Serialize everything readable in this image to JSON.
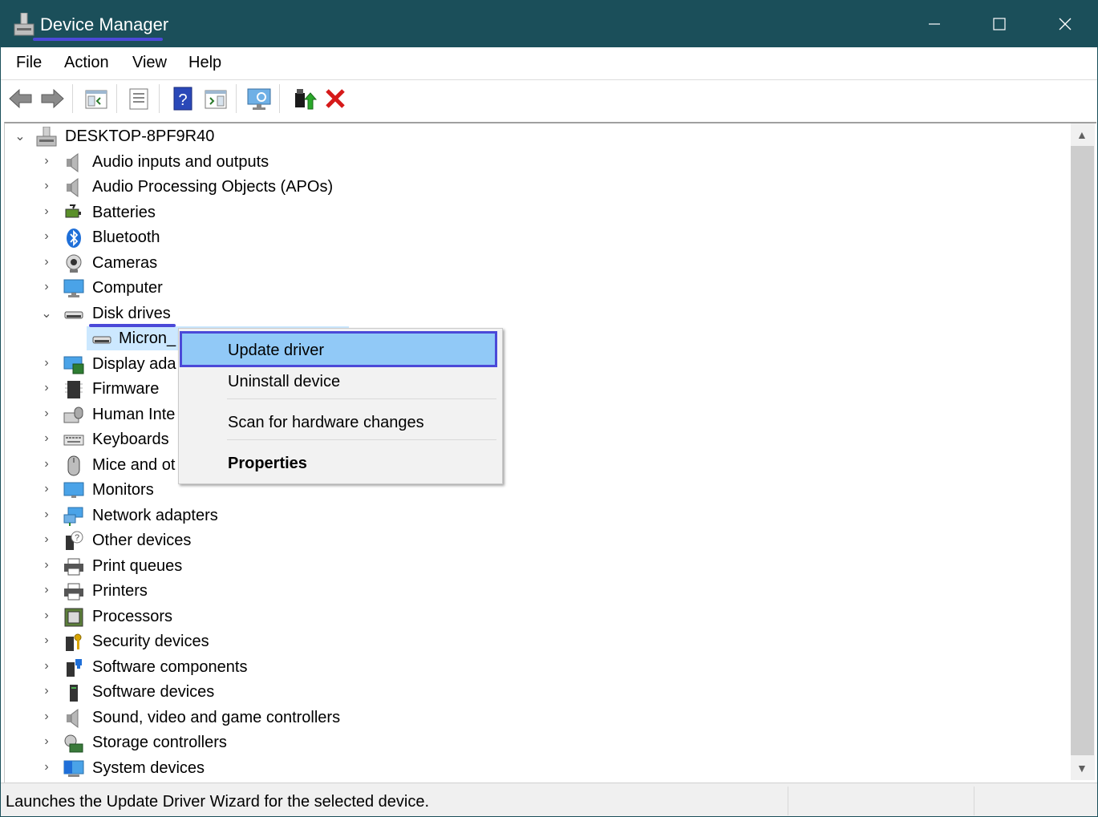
{
  "window": {
    "title": "Device Manager",
    "colors": {
      "titlebar": "#1b4f5a",
      "highlight": "#4b49d8",
      "selection": "#91c9f7"
    }
  },
  "menubar": {
    "items": [
      "File",
      "Action",
      "View",
      "Help"
    ]
  },
  "toolbar": {
    "icons": [
      "back-arrow-icon",
      "forward-arrow-icon",
      "show-hide-console-tree-icon",
      "properties-icon",
      "help-icon",
      "action-pane-icon",
      "monitor-scan-icon",
      "update-driver-icon",
      "uninstall-icon"
    ]
  },
  "tree": {
    "root": "DESKTOP-8PF9R40",
    "categories": [
      {
        "label": "Audio inputs and outputs",
        "icon": "speaker-icon"
      },
      {
        "label": "Audio Processing Objects (APOs)",
        "icon": "speaker-icon"
      },
      {
        "label": "Batteries",
        "icon": "battery-icon"
      },
      {
        "label": "Bluetooth",
        "icon": "bluetooth-icon"
      },
      {
        "label": "Cameras",
        "icon": "camera-icon"
      },
      {
        "label": "Computer",
        "icon": "computer-icon"
      },
      {
        "label": "Disk drives",
        "icon": "disk-drive-icon",
        "expanded": true
      },
      {
        "label": "Micron_",
        "icon": "disk-drive-icon",
        "child": true
      },
      {
        "label": "Display ada",
        "icon": "display-adapter-icon"
      },
      {
        "label": "Firmware",
        "icon": "firmware-icon"
      },
      {
        "label": "Human Inte",
        "icon": "hid-icon"
      },
      {
        "label": "Keyboards",
        "icon": "keyboard-icon"
      },
      {
        "label": "Mice and ot",
        "icon": "mouse-icon"
      },
      {
        "label": "Monitors",
        "icon": "monitor-icon"
      },
      {
        "label": "Network adapters",
        "icon": "network-icon"
      },
      {
        "label": "Other devices",
        "icon": "other-devices-icon"
      },
      {
        "label": "Print queues",
        "icon": "printer-icon"
      },
      {
        "label": "Printers",
        "icon": "printer-icon"
      },
      {
        "label": "Processors",
        "icon": "processor-icon"
      },
      {
        "label": "Security devices",
        "icon": "security-icon"
      },
      {
        "label": "Software components",
        "icon": "software-component-icon"
      },
      {
        "label": "Software devices",
        "icon": "software-device-icon"
      },
      {
        "label": "Sound, video and game controllers",
        "icon": "speaker-icon"
      },
      {
        "label": "Storage controllers",
        "icon": "storage-icon"
      },
      {
        "label": "System devices",
        "icon": "system-icon"
      }
    ]
  },
  "context_menu": {
    "items": [
      {
        "label": "Update driver",
        "highlighted": true
      },
      {
        "label": "Uninstall device"
      },
      {
        "label": "Scan for hardware changes"
      },
      {
        "label": "Properties",
        "bold": true
      }
    ]
  },
  "statusbar": {
    "text": "Launches the Update Driver Wizard for the selected device."
  }
}
